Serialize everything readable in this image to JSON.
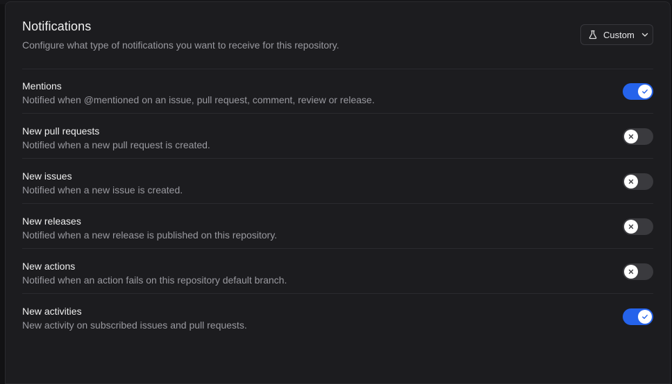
{
  "header": {
    "title": "Notifications",
    "subtitle": "Configure what type of notifications you want to receive for this repository.",
    "mode_button": {
      "label": "Custom",
      "icon": "flask-icon",
      "chevron": "chevron-down-icon"
    }
  },
  "colors": {
    "accent": "#2563eb",
    "toggle_off": "#3a3a3e",
    "background": "#1c1c1f"
  },
  "settings": [
    {
      "title": "Mentions",
      "description": "Notified when @mentioned on an issue, pull request, comment, review or release.",
      "enabled": true
    },
    {
      "title": "New pull requests",
      "description": "Notified when a new pull request is created.",
      "enabled": false
    },
    {
      "title": "New issues",
      "description": "Notified when a new issue is created.",
      "enabled": false
    },
    {
      "title": "New releases",
      "description": "Notified when a new release is published on this repository.",
      "enabled": false
    },
    {
      "title": "New actions",
      "description": "Notified when an action fails on this repository default branch.",
      "enabled": false
    },
    {
      "title": "New activities",
      "description": "New activity on subscribed issues and pull requests.",
      "enabled": true
    }
  ]
}
